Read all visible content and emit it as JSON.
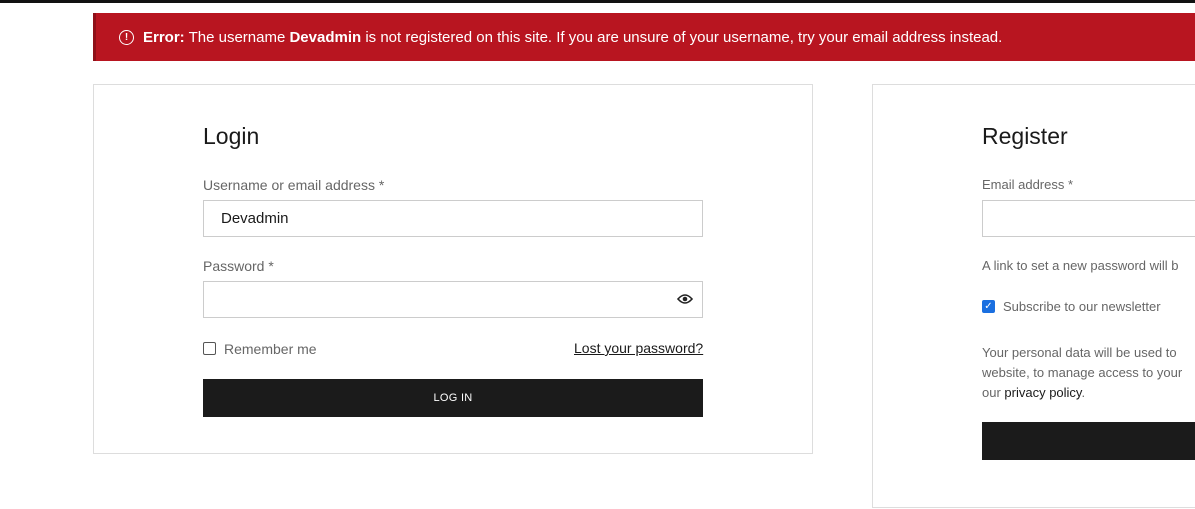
{
  "error": {
    "icon": "exclamation-circle-icon",
    "prefix": "Error:",
    "text1": " The username ",
    "username": "Devadmin",
    "text2": " is not registered on this site. If you are unsure of your username, try your email address instead.",
    "color": "#b81520"
  },
  "login": {
    "title": "Login",
    "username_label": "Username or email address *",
    "username_value": "Devadmin",
    "password_label": "Password *",
    "password_value": "",
    "remember_label": "Remember me",
    "remember_checked": false,
    "lost_password": "Lost your password?",
    "submit": "LOG IN"
  },
  "register": {
    "title": "Register",
    "email_label": "Email address *",
    "email_value": "",
    "password_note": "A link to set a new password will b",
    "newsletter_label": "Subscribe to our newsletter",
    "newsletter_checked": true,
    "privacy_line1": "Your personal data will be used to",
    "privacy_line2": "website, to manage access to your",
    "privacy_line3_pre": "our ",
    "privacy_link": "privacy policy",
    "privacy_line3_post": "."
  }
}
